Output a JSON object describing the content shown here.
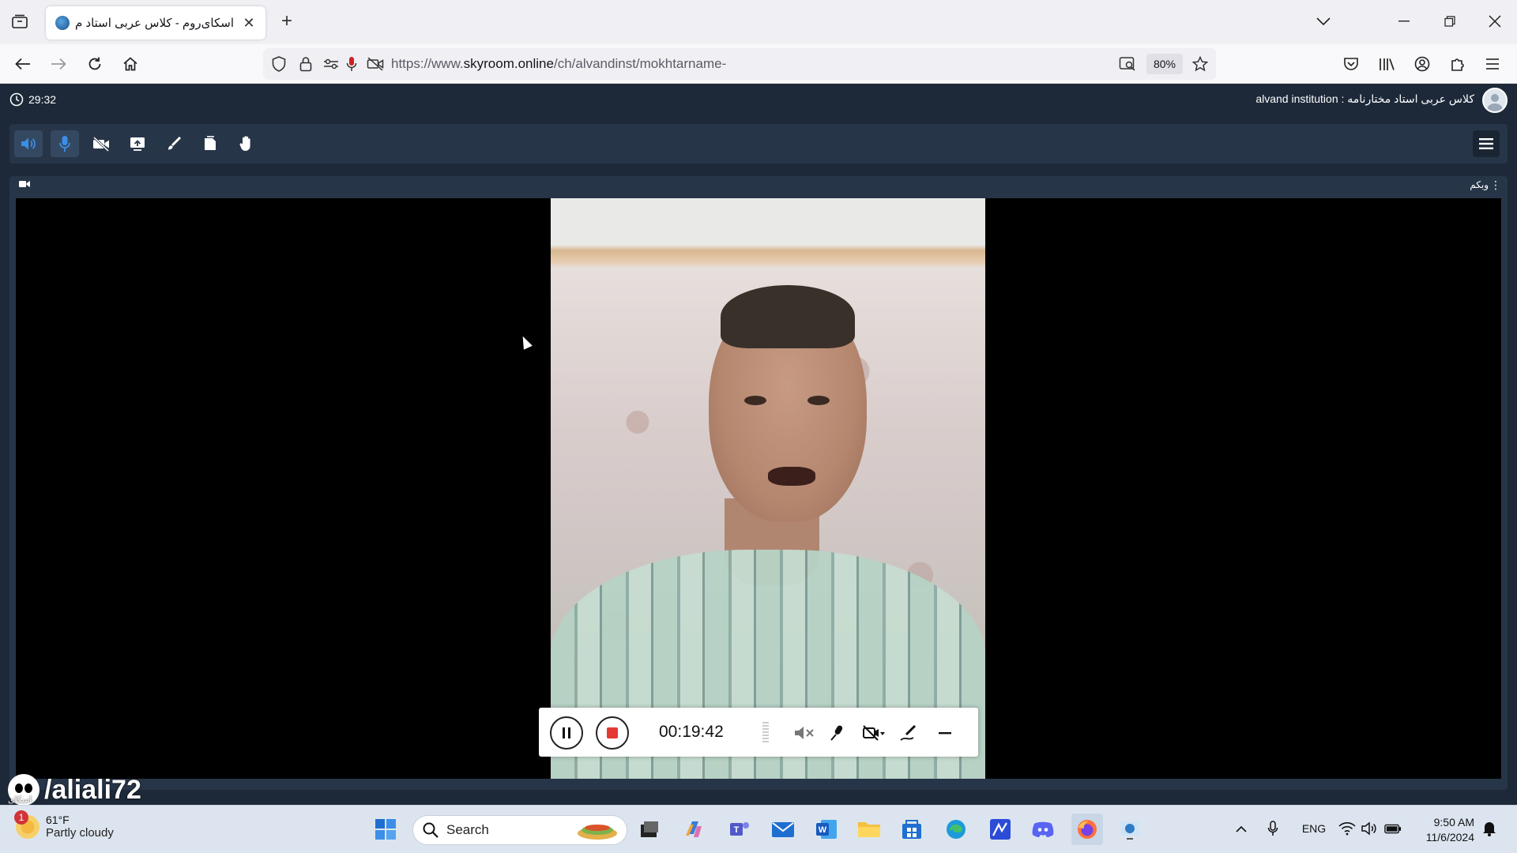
{
  "browser": {
    "tab_title": "اسکای‌روم - کلاس عربی استاد م",
    "tab_close": "✕",
    "new_tab": "+",
    "url_prefix": "https://www.",
    "url_domain": "skyroom.online",
    "url_path": "/ch/alvandinst/mokhtarname-",
    "zoom": "80%"
  },
  "app": {
    "timer": "29:32",
    "room_title": "کلاس عربی استاد مختارنامه : alvand institution",
    "panel_title": "وبکم",
    "panel_menu": "⋮",
    "accent": "#3a8ee6"
  },
  "recorder": {
    "time": "00:19:42",
    "stop_color": "#e53935"
  },
  "watermark": {
    "handle": "/aliali72",
    "small": "اسکای"
  },
  "taskbar": {
    "weather_badge": "1",
    "temperature": "61°F",
    "condition": "Partly cloudy",
    "search_label": "Search",
    "language": "ENG",
    "time": "9:50 AM",
    "date": "11/6/2024"
  }
}
